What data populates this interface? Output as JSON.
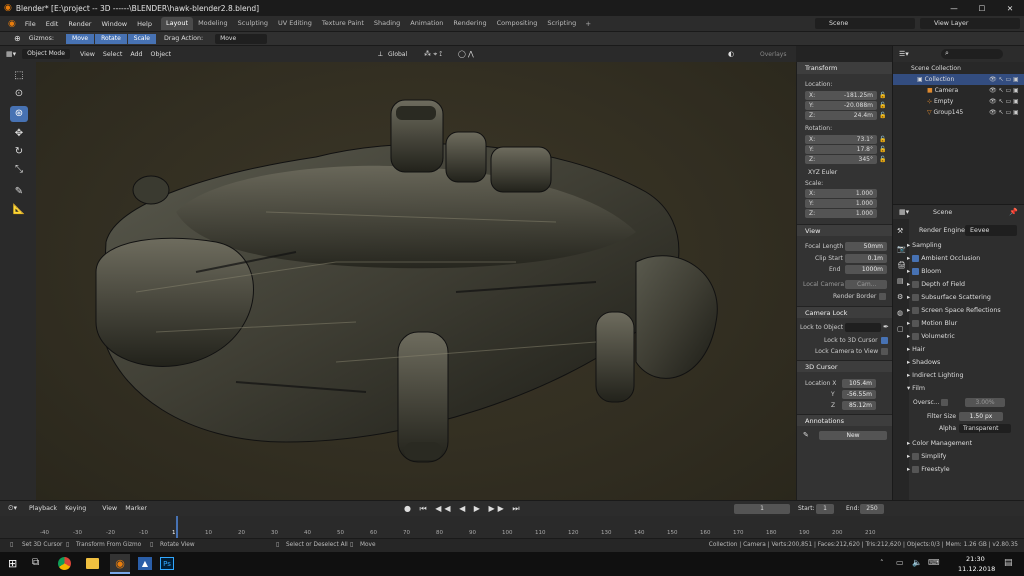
{
  "titlebar": {
    "title": "Blender* [E:\\project -- 3D ------\\BLENDER\\hawk-blender2.8.blend]"
  },
  "menu": [
    "File",
    "Edit",
    "Render",
    "Window",
    "Help"
  ],
  "workspaces": [
    "Layout",
    "Modeling",
    "Sculpting",
    "UV Editing",
    "Texture Paint",
    "Shading",
    "Animation",
    "Rendering",
    "Compositing",
    "Scripting"
  ],
  "scene": {
    "label": "Scene"
  },
  "viewlayer": {
    "label": "View Layer"
  },
  "toolhdr": {
    "gizmos": "Gizmos:",
    "move": "Move",
    "rotate": "Rotate",
    "scale": "Scale",
    "drag_action": "Drag Action:",
    "drag_value": "Move"
  },
  "viewhdr": {
    "mode": "Object Mode",
    "view": "View",
    "select": "Select",
    "add": "Add",
    "object": "Object",
    "orientation": "Global",
    "overlays": "Overlays",
    "shading": "Shading"
  },
  "npanel": {
    "transform": "Transform",
    "location": "Location:",
    "loc_x": "-181.25m",
    "loc_y": "-20.088m",
    "loc_z": "24.4m",
    "rotation": "Rotation:",
    "rot_x": "73.1°",
    "rot_y": "17.8°",
    "rot_z": "345°",
    "rot_mode": "XYZ Euler",
    "scale": "Scale:",
    "sc_x": "1.000",
    "sc_y": "1.000",
    "sc_z": "1.000",
    "x": "X:",
    "y": "Y:",
    "z": "Z:",
    "view": "View",
    "focal_label": "Focal Length",
    "focal": "50mm",
    "clip_start_label": "Clip Start",
    "clip_start": "0.1m",
    "end_label": "End",
    "clip_end": "1000m",
    "local_camera": "Local Camera",
    "local_camera_val": "Cam...",
    "render_border": "Render Border",
    "camera_lock": "Camera Lock",
    "lock_to_object": "Lock to Object",
    "lock_3d_cursor": "Lock to 3D Cursor",
    "lock_camera_view": "Lock Camera to View",
    "cursor": "3D Cursor",
    "cur_loc_label": "Location X",
    "cur_x": "105.4m",
    "cur_y_label": "Y",
    "cur_y": "-56.55m",
    "cur_z_label": "Z",
    "cur_z": "85.12m",
    "annotations": "Annotations",
    "new": "New"
  },
  "outliner": {
    "scene_collection": "Scene Collection",
    "collection": "Collection",
    "camera": "Camera",
    "empty": "Empty",
    "group": "Group145"
  },
  "props": {
    "scene": "Scene",
    "render_engine_label": "Render Engine",
    "render_engine": "Eevee",
    "sections": [
      "Sampling",
      "Ambient Occlusion",
      "Bloom",
      "Depth of Field",
      "Subsurface Scattering",
      "Screen Space Reflections",
      "Motion Blur",
      "Volumetric",
      "Hair",
      "Shadows",
      "Indirect Lighting",
      "Film"
    ],
    "overscan": "Oversc...",
    "overscan_val": "3.00%",
    "filter_label": "Filter Size",
    "filter": "1.50 px",
    "alpha_label": "Alpha",
    "alpha": "Transparent",
    "color_mgmt": "Color Management",
    "simplify": "Simplify",
    "freestyle": "Freestyle"
  },
  "timeline": {
    "playback": "Playback",
    "keying": "Keying",
    "view": "View",
    "marker": "Marker",
    "frame": "1",
    "start_label": "Start:",
    "start": "1",
    "end_label": "End:",
    "end": "250",
    "ticks": [
      "-40",
      "-30",
      "-20",
      "-10",
      "1",
      "10",
      "20",
      "30",
      "40",
      "50",
      "60",
      "70",
      "80",
      "90",
      "100",
      "110",
      "120",
      "130",
      "140",
      "150",
      "160",
      "170",
      "180",
      "190",
      "200",
      "210"
    ]
  },
  "status": {
    "set_cursor": "Set 3D Cursor",
    "transform_gizmo": "Transform From Gizmo",
    "rotate_view": "Rotate View",
    "select": "Select or Deselect All",
    "move": "Move",
    "info": "Collection | Camera | Verts:200,851 | Faces:212,620 | Tris:212,620 | Objects:0/3 | Mem: 1.26 GB | v2.80.35"
  },
  "taskbar": {
    "time": "21:30",
    "date": "11.12.2018"
  },
  "colors": {
    "accent": "#4772b3",
    "title_bg": "#1b1b1b",
    "viewport_bg": "#332f22"
  }
}
